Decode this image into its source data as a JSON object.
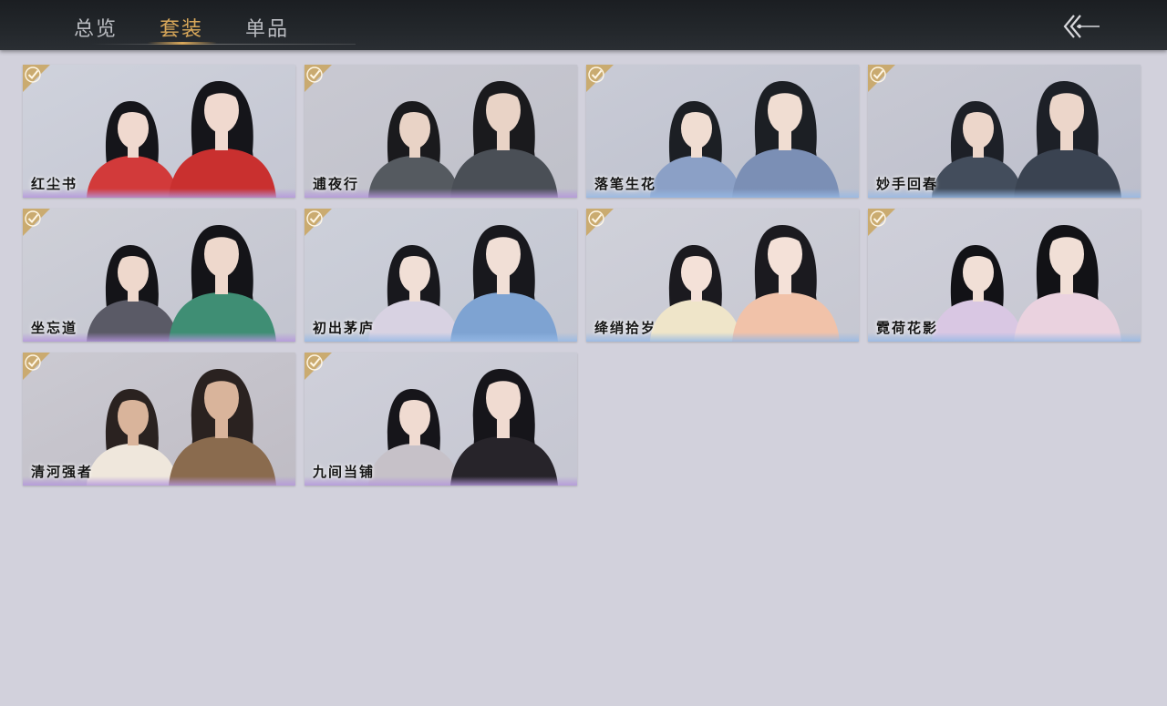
{
  "header": {
    "tabs": [
      {
        "label": "总览"
      },
      {
        "label": "套装"
      },
      {
        "label": "单品"
      }
    ],
    "active_tab": 1,
    "back_icon": "double-chevron-left-arrow-icon"
  },
  "colors": {
    "active_tab": "#d9a85a",
    "inactive_tab": "#b9bbc0",
    "badge_gold": "#c9a96a",
    "background": "#d2d1dc"
  },
  "outfits": [
    {
      "name": "红尘书",
      "owned": true,
      "theme": "red"
    },
    {
      "name": "逋夜行",
      "owned": true,
      "theme": "grey"
    },
    {
      "name": "落笔生花",
      "owned": true,
      "theme": "blue"
    },
    {
      "name": "妙手回春",
      "owned": true,
      "theme": "slate"
    },
    {
      "name": "坐忘道",
      "owned": true,
      "theme": "green"
    },
    {
      "name": "初出茅庐",
      "owned": true,
      "theme": "lightblue"
    },
    {
      "name": "绛绡拾岁",
      "owned": true,
      "theme": "peach"
    },
    {
      "name": "霓荷花影",
      "owned": true,
      "theme": "pink"
    },
    {
      "name": "清河强者",
      "owned": true,
      "theme": "wood"
    },
    {
      "name": "九间当铺",
      "owned": true,
      "theme": "dark"
    }
  ]
}
